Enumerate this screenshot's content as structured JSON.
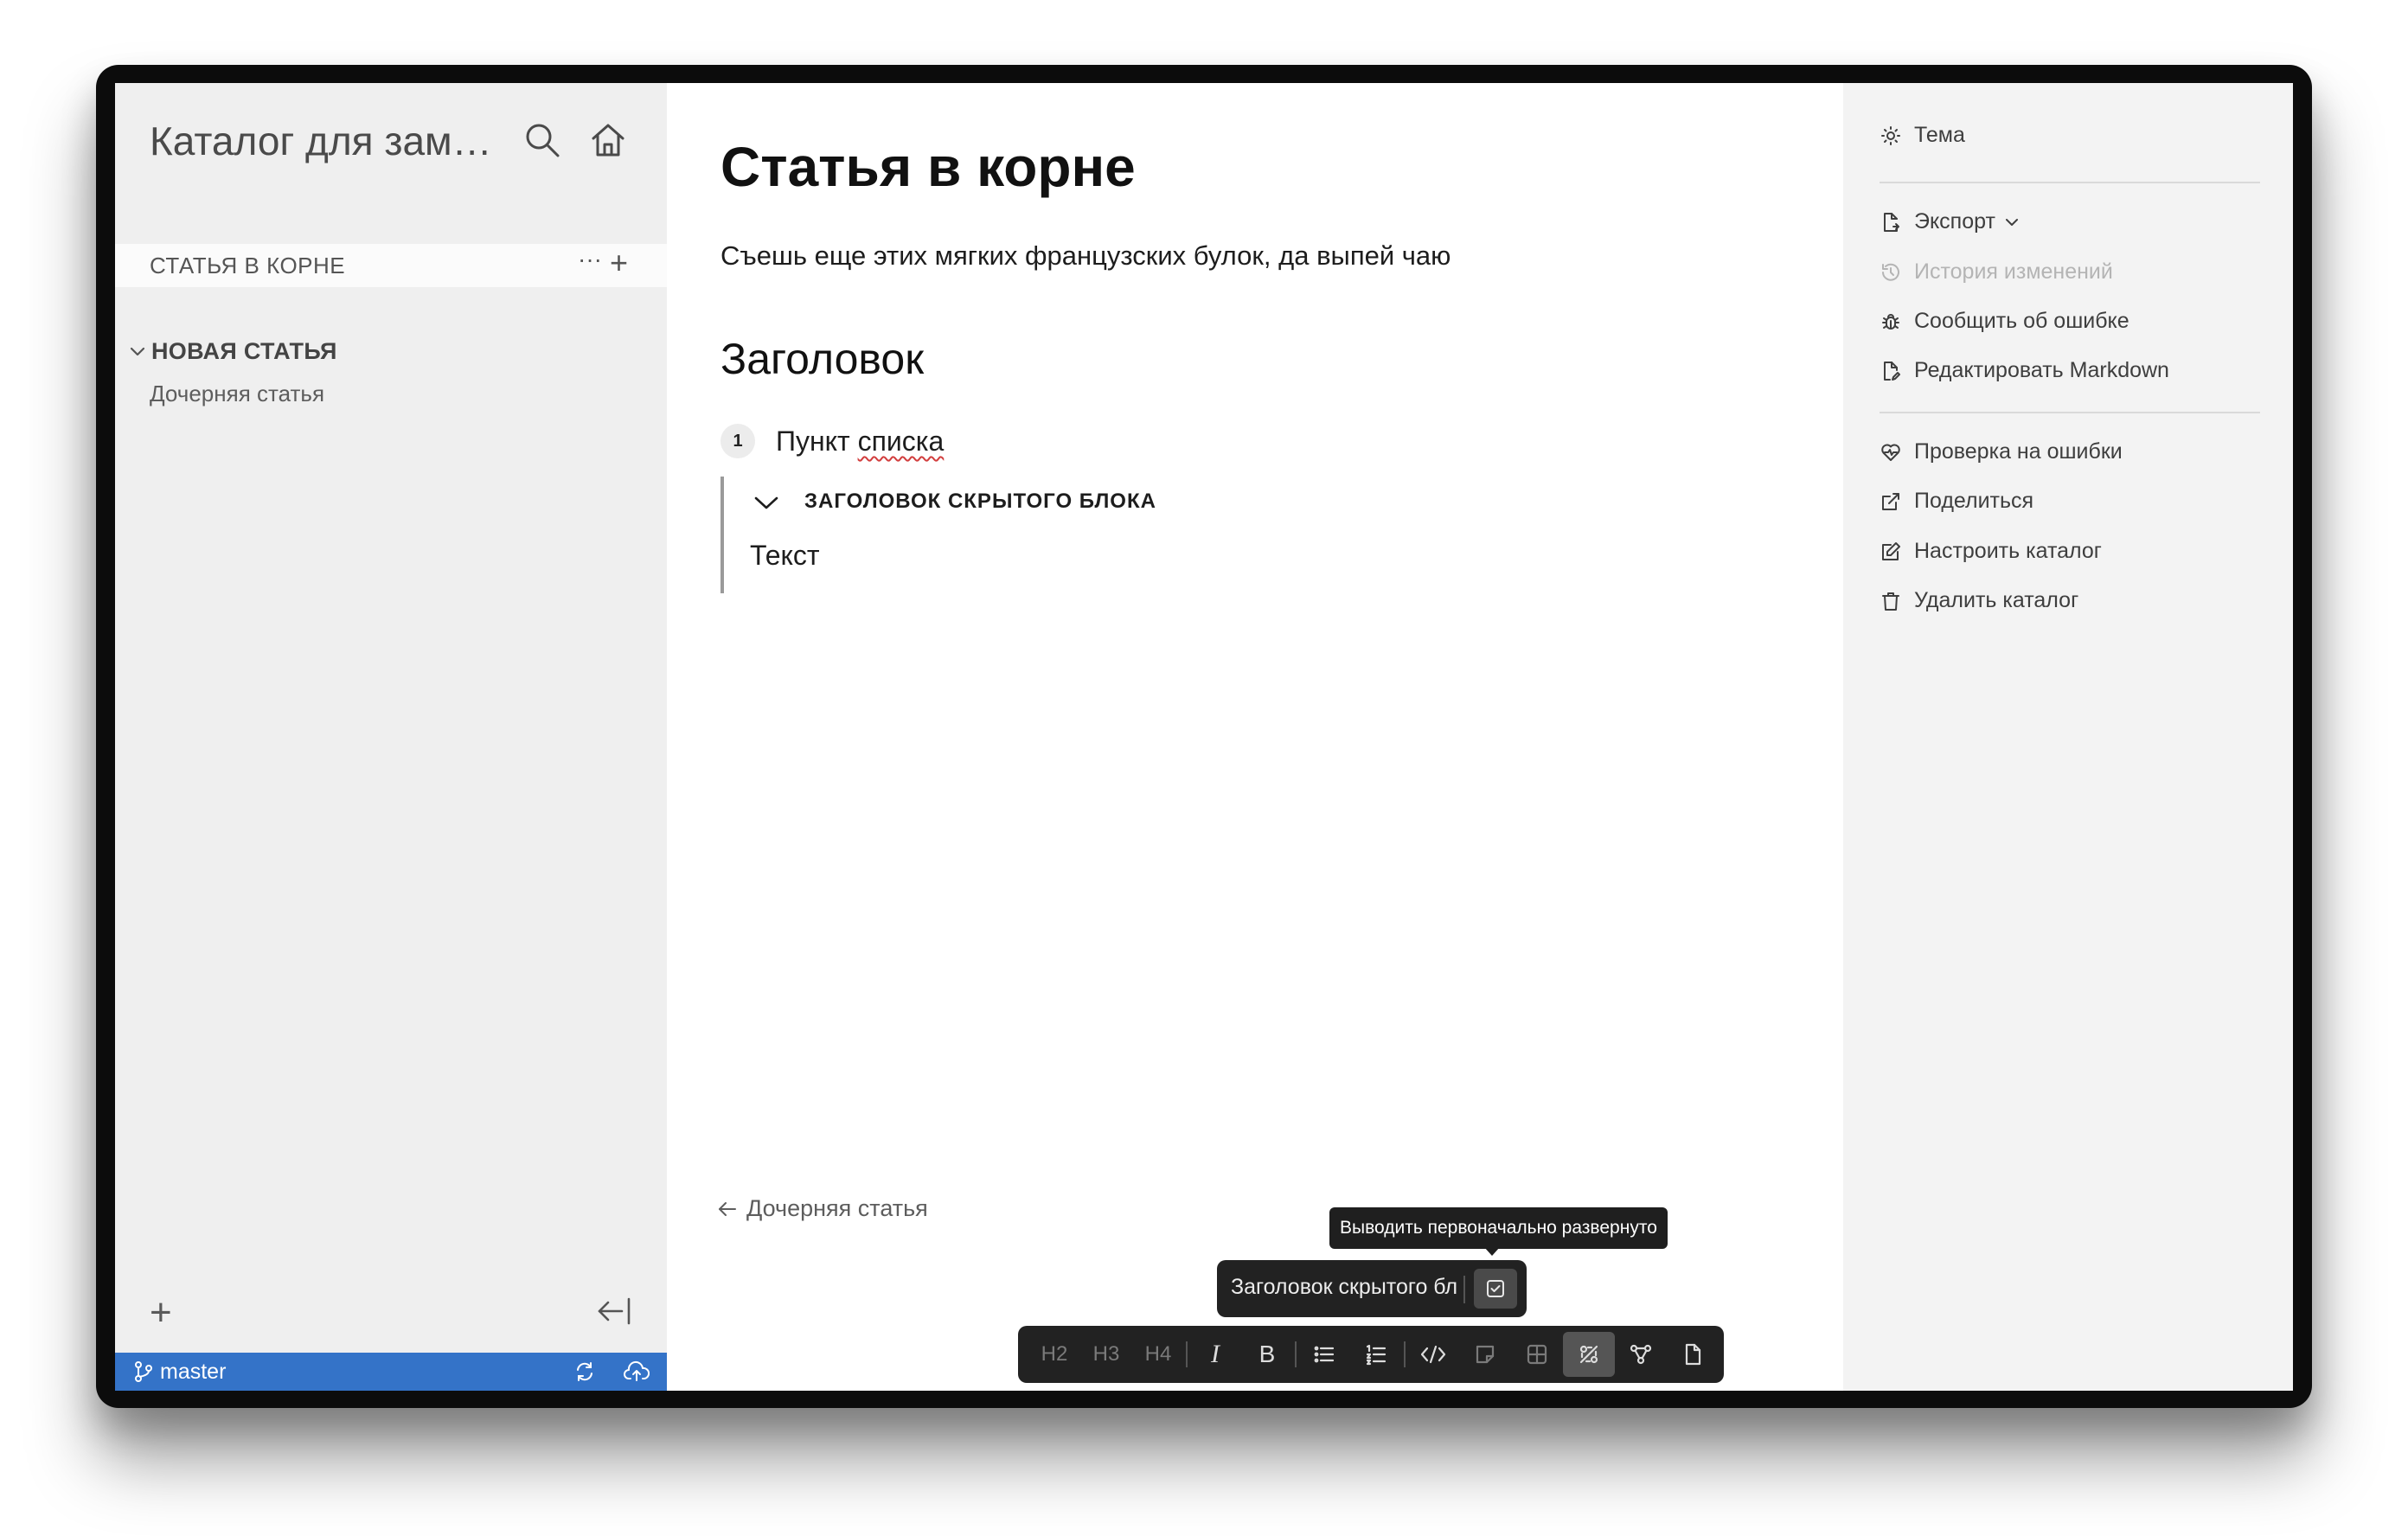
{
  "sidebar": {
    "catalog_title": "Каталог для заме...",
    "root_article": "СТАТЬЯ В КОРНЕ",
    "root_more": "···",
    "root_add": "+",
    "tree": {
      "parent_label": "НОВАЯ СТАТЬЯ",
      "child_label": "Дочерняя статья"
    },
    "bottom_add": "+"
  },
  "statusbar": {
    "branch": "master",
    "color": "#3473c8"
  },
  "article": {
    "title": "Статья в корне",
    "paragraph": "Съешь еще этих мягких французских булок, да выпей чаю",
    "heading": "Заголовок",
    "list_number": "1",
    "list_item_prefix": "Пункт ",
    "list_item_misspelled": "списка",
    "hidden_block_title": "ЗАГОЛОВОК СКРЫТОГО БЛОКА",
    "hidden_block_text": "Текст",
    "prev_article": "Дочерняя статья"
  },
  "hidden_block_toolbar": {
    "title_value": "Заголовок скрытого бл",
    "tooltip": "Выводить первоначально развернуто"
  },
  "editor_toolbar": {
    "h2": "H2",
    "h3": "H3",
    "h4": "H4",
    "italic": "I",
    "bold": "B",
    "active_tool": "hidden-block",
    "icons": [
      "bullet-list-icon",
      "numbered-list-icon",
      "code-icon",
      "note-icon",
      "table-icon",
      "hidden-block-icon",
      "diagram-icon",
      "file-icon"
    ]
  },
  "right_panel": {
    "theme": "Тема",
    "export": "Экспорт",
    "history": "История изменений",
    "report_bug": "Сообщить об ошибке",
    "edit_markdown": "Редактировать Markdown",
    "check_errors": "Проверка на ошибки",
    "share": "Поделиться",
    "configure_catalog": "Настроить каталог",
    "delete_catalog": "Удалить каталог"
  }
}
